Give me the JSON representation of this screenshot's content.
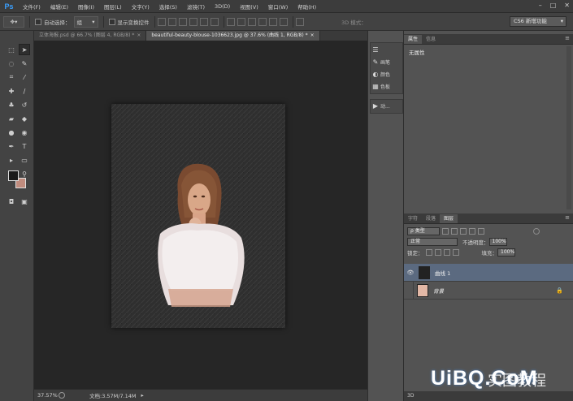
{
  "app": {
    "logo": "Ps"
  },
  "menu": [
    "文件(F)",
    "编辑(E)",
    "图像(I)",
    "图层(L)",
    "文字(Y)",
    "选择(S)",
    "滤镜(T)",
    "3D(D)",
    "视图(V)",
    "窗口(W)",
    "帮助(H)"
  ],
  "window_controls": [
    "–",
    "□",
    "✕"
  ],
  "options_bar": {
    "auto_select_label": "自动选择：",
    "auto_select_value": "组",
    "transform_label": "显示变换控件",
    "mode_3d": "3D 模式：",
    "workspace": "CS6 新增功能"
  },
  "doc_tabs": [
    {
      "label": "立体海报.psd @ 66.7% (图层 4, RGB/8) *",
      "close": "×",
      "active": false
    },
    {
      "label": "beautiful-beauty-blouse-1036623.jpg @ 37.6% (曲线 1, RGB/8) *",
      "close": "×",
      "active": true
    }
  ],
  "status": {
    "zoom": "37.57%",
    "doc_info": "文档:3.57M/7.14M",
    "arrow": "▸"
  },
  "dock": [
    {
      "label": "",
      "icon": "sliders-icon"
    },
    {
      "label": "画笔",
      "icon": "brush-icon"
    },
    {
      "label": "颜色",
      "icon": "color-icon"
    },
    {
      "label": "色板",
      "icon": "swatches-icon"
    },
    {
      "label": "动...",
      "icon": "play-icon"
    }
  ],
  "properties_panel": {
    "tabs": [
      "属性",
      "信息"
    ],
    "empty_text": "无属性"
  },
  "layers_panel": {
    "tabs": [
      "字符",
      "段落",
      "图层"
    ],
    "filter_label": "ρ 类型",
    "blend_mode": "正常",
    "opacity_label": "不透明度：",
    "opacity_value": "100%",
    "lock_label": "锁定：",
    "fill_label": "填充：",
    "fill_value": "100%",
    "layers": [
      {
        "name": "曲线 1",
        "visible": true,
        "selected": true,
        "locked": false
      },
      {
        "name": "背景",
        "visible": false,
        "selected": false,
        "locked": true
      }
    ],
    "bottom_label": "3D"
  },
  "watermark": {
    "main": "UiBQ.CoM",
    "sub": "实图教程"
  },
  "colors": {
    "foreground": "#1a1a1a",
    "background": "#c08c7e",
    "selection": "#5b6a80",
    "accent": "#3aa0ff"
  }
}
